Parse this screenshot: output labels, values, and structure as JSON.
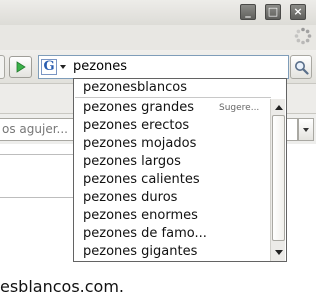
{
  "window": {
    "minimize_glyph": "_",
    "maximize_glyph": "□",
    "close_glyph": "×"
  },
  "search": {
    "engine_letter": "G",
    "query": "pezones"
  },
  "page_toolbar": {
    "find_text": "os agujer..."
  },
  "suggestions": {
    "items": [
      "pezonesblancos",
      "pezones grandes",
      "pezones erectos",
      "pezones mojados",
      "pezones largos",
      "pezones calientes",
      "pezones duros",
      "pezones enormes",
      "pezones de famo...",
      "pezones gigantes"
    ],
    "hint": "Sugere..."
  },
  "content": {
    "url_fragment": "esblancos.com."
  },
  "colors": {
    "go_arrow": "#3bb24a",
    "search_border": "#7f9db9"
  }
}
